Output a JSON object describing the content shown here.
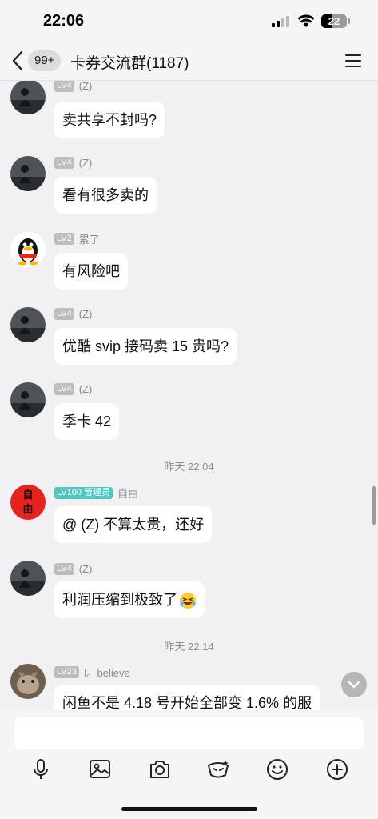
{
  "status": {
    "time": "22:06",
    "battery": "22"
  },
  "nav": {
    "unread_badge": "99+",
    "title": "卡券交流群(1187)"
  },
  "messages": [
    {
      "level": "LV4",
      "name": "(Z)",
      "text": "卖共享不封吗?"
    },
    {
      "level": "LV4",
      "name": "(Z)",
      "text": "看有很多卖的"
    },
    {
      "level": "LV2",
      "name": "累了",
      "text": "有风险吧"
    },
    {
      "level": "LV4",
      "name": "(Z)",
      "text": "优酷 svip 接码卖 15 贵吗?"
    },
    {
      "level": "LV4",
      "name": "(Z)",
      "text": "季卡 42"
    },
    {
      "level": "LV100 管理员",
      "name": "自由",
      "avatar_text": "自\n由",
      "text": "@ (Z) 不算太贵，还好"
    },
    {
      "level": "LV4",
      "name": "(Z)",
      "text": "利润压缩到极致了"
    },
    {
      "level": "LV23",
      "name": "I。believe",
      "text": "闲鱼不是 4.18 号开始全部变 1.6% 的服"
    }
  ],
  "time_separators": [
    "昨天 22:04",
    "昨天 22:14"
  ],
  "toolbar": [
    "microphone-icon",
    "image-icon",
    "camera-icon",
    "red-packet-icon",
    "emoji-icon",
    "plus-icon"
  ],
  "colors": {
    "admin_badge": "#4dc8c0",
    "level_badge": "#bdbdc1",
    "admin_avatar": "#e8231e"
  }
}
